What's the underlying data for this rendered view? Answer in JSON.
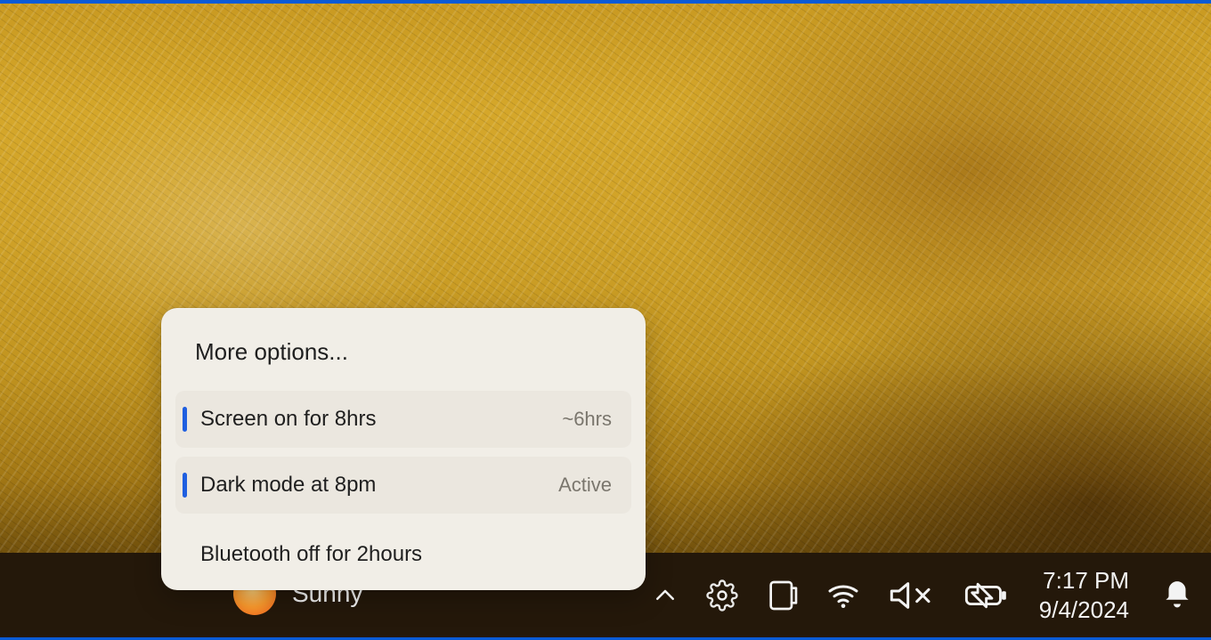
{
  "weather": {
    "condition": "Sunny"
  },
  "popup": {
    "title": "More options...",
    "items": [
      {
        "label": "Screen on for 8hrs",
        "right": "~6hrs",
        "accent": true
      },
      {
        "label": "Dark mode at 8pm",
        "right": "Active",
        "accent": true
      },
      {
        "label": "Bluetooth off for 2hours",
        "right": "",
        "accent": false
      }
    ]
  },
  "tray": {
    "time": "7:17 PM",
    "date": "9/4/2024"
  },
  "icons": {
    "chevron_up": "chevron-up-icon",
    "settings": "settings-icon",
    "tablet": "tablet-mode-icon",
    "wifi": "wifi-icon",
    "mute": "volume-mute-icon",
    "battery": "battery-saver-icon",
    "bell": "notifications-icon",
    "sun": "weather-sun-icon"
  }
}
